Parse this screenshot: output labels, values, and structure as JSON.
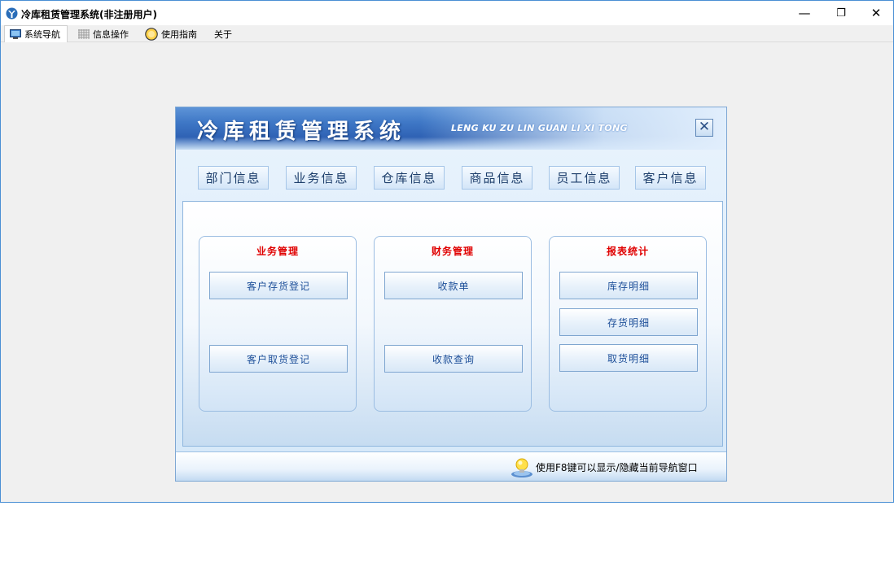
{
  "window": {
    "title": "冷库租赁管理系统(非注册用户)",
    "icons": {
      "app": "app-logo-icon",
      "minimize": "minimize-icon",
      "maximize": "restore-icon",
      "close": "close-icon"
    },
    "controls": {
      "minimize": "—",
      "maximize": "❐",
      "close": "✕"
    }
  },
  "tabs": [
    {
      "label": "系统导航",
      "icon": "monitor-icon",
      "active": true
    },
    {
      "label": "信息操作",
      "icon": "grid-icon",
      "active": false
    },
    {
      "label": "使用指南",
      "icon": "help-icon",
      "active": false
    },
    {
      "label": "关于",
      "icon": "",
      "active": false
    }
  ],
  "panel": {
    "title": "冷库租赁管理系统",
    "subtitle": "LENG KU ZU LIN GUAN LI XI TONG",
    "close_symbol": "✕",
    "toolbar": [
      "部门信息",
      "业务信息",
      "仓库信息",
      "商品信息",
      "员工信息",
      "客户信息"
    ],
    "groups": [
      {
        "title": "业务管理",
        "buttons": [
          "客户存货登记",
          "客户取货登记"
        ]
      },
      {
        "title": "财务管理",
        "buttons": [
          "收款单",
          "收款查询"
        ]
      },
      {
        "title": "报表统计",
        "buttons": [
          "库存明细",
          "存货明细",
          "取货明细"
        ]
      }
    ],
    "footer_hint": "使用F8键可以显示/隐藏当前导航窗口"
  },
  "colors": {
    "group_title": "#e00000",
    "button_text": "#1d4f99",
    "header_blue": "#2f62b4"
  }
}
